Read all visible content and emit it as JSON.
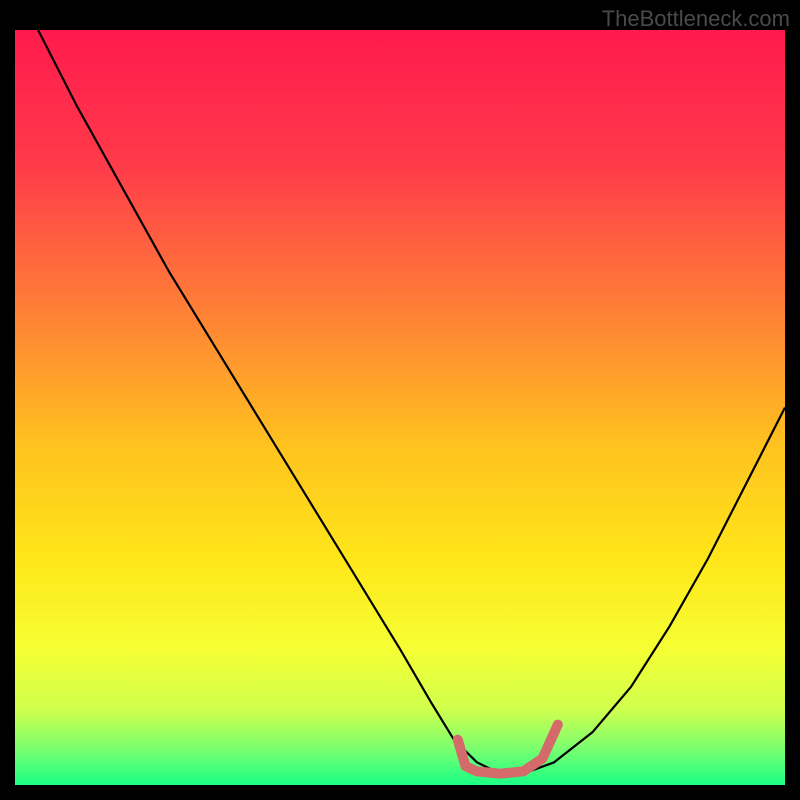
{
  "watermark": "TheBottleneck.com",
  "chart_data": {
    "type": "line",
    "title": "",
    "xlabel": "",
    "ylabel": "",
    "xlim": [
      0,
      100
    ],
    "ylim": [
      0,
      100
    ],
    "gradient_stops": [
      {
        "offset": 0,
        "color": "#ff1a4d"
      },
      {
        "offset": 18,
        "color": "#ff3b4a"
      },
      {
        "offset": 40,
        "color": "#ff8a33"
      },
      {
        "offset": 55,
        "color": "#ffc21f"
      },
      {
        "offset": 70,
        "color": "#ffe61a"
      },
      {
        "offset": 82,
        "color": "#f5ff33"
      },
      {
        "offset": 90,
        "color": "#cfff4d"
      },
      {
        "offset": 95,
        "color": "#7dff6e"
      },
      {
        "offset": 100,
        "color": "#1aff85"
      }
    ],
    "series": [
      {
        "name": "bottleneck-curve",
        "color": "#000000",
        "width": 2.2,
        "x": [
          3,
          8,
          14,
          20,
          26,
          32,
          38,
          44,
          50,
          54,
          57,
          60,
          63,
          66,
          70,
          75,
          80,
          85,
          90,
          95,
          100
        ],
        "y": [
          100,
          90,
          79,
          68,
          58,
          48,
          38,
          28,
          18,
          11,
          6,
          3,
          1.5,
          1.5,
          3,
          7,
          13,
          21,
          30,
          40,
          50
        ]
      },
      {
        "name": "optimal-range-marker",
        "color": "#d46a6a",
        "width": 10,
        "linecap": "round",
        "x": [
          57.5,
          58.5,
          60,
          63,
          66,
          68.5,
          70.5
        ],
        "y": [
          6,
          2.5,
          1.8,
          1.5,
          1.8,
          3.5,
          8
        ]
      }
    ]
  }
}
